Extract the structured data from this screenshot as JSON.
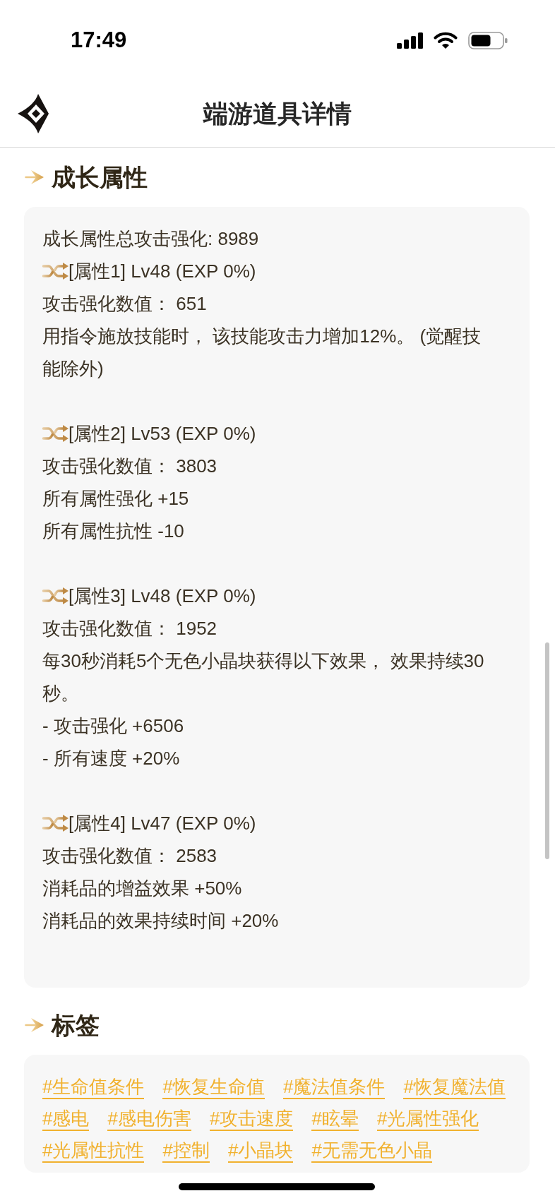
{
  "status_bar": {
    "time": "17:49"
  },
  "header": {
    "title": "端游道具详情"
  },
  "sections": [
    {
      "kind": "attributes",
      "title": "成长属性",
      "summary": "成长属性总攻击强化: 8989",
      "attributes": [
        {
          "header": "[属性1] Lv48 (EXP 0%)",
          "lines": [
            "攻击强化数值： 651",
            "用指令施放技能时， 该技能攻击力增加12%。 (觉醒技能除外)"
          ]
        },
        {
          "header": "[属性2] Lv53 (EXP 0%)",
          "lines": [
            "攻击强化数值： 3803",
            "所有属性强化 +15",
            "所有属性抗性 -10"
          ]
        },
        {
          "header": "[属性3] Lv48 (EXP 0%)",
          "lines": [
            "攻击强化数值： 1952",
            "每30秒消耗5个无色小晶块获得以下效果， 效果持续30秒。",
            "- 攻击强化 +6506",
            "- 所有速度 +20%"
          ]
        },
        {
          "header": "[属性4] Lv47 (EXP 0%)",
          "lines": [
            "攻击强化数值： 2583",
            "消耗品的增益效果 +50%",
            "消耗品的效果持续时间 +20%"
          ]
        }
      ]
    },
    {
      "kind": "tags",
      "title": "标签",
      "tags": [
        "#生命值条件",
        "#恢复生命值",
        "#魔法值条件",
        "#恢复魔法值",
        "#感电",
        "#感电伤害",
        "#攻击速度",
        "#眩晕",
        "#光属性强化",
        "#光属性抗性",
        "#控制",
        "#小晶块",
        "#无需无色小晶"
      ]
    }
  ]
}
